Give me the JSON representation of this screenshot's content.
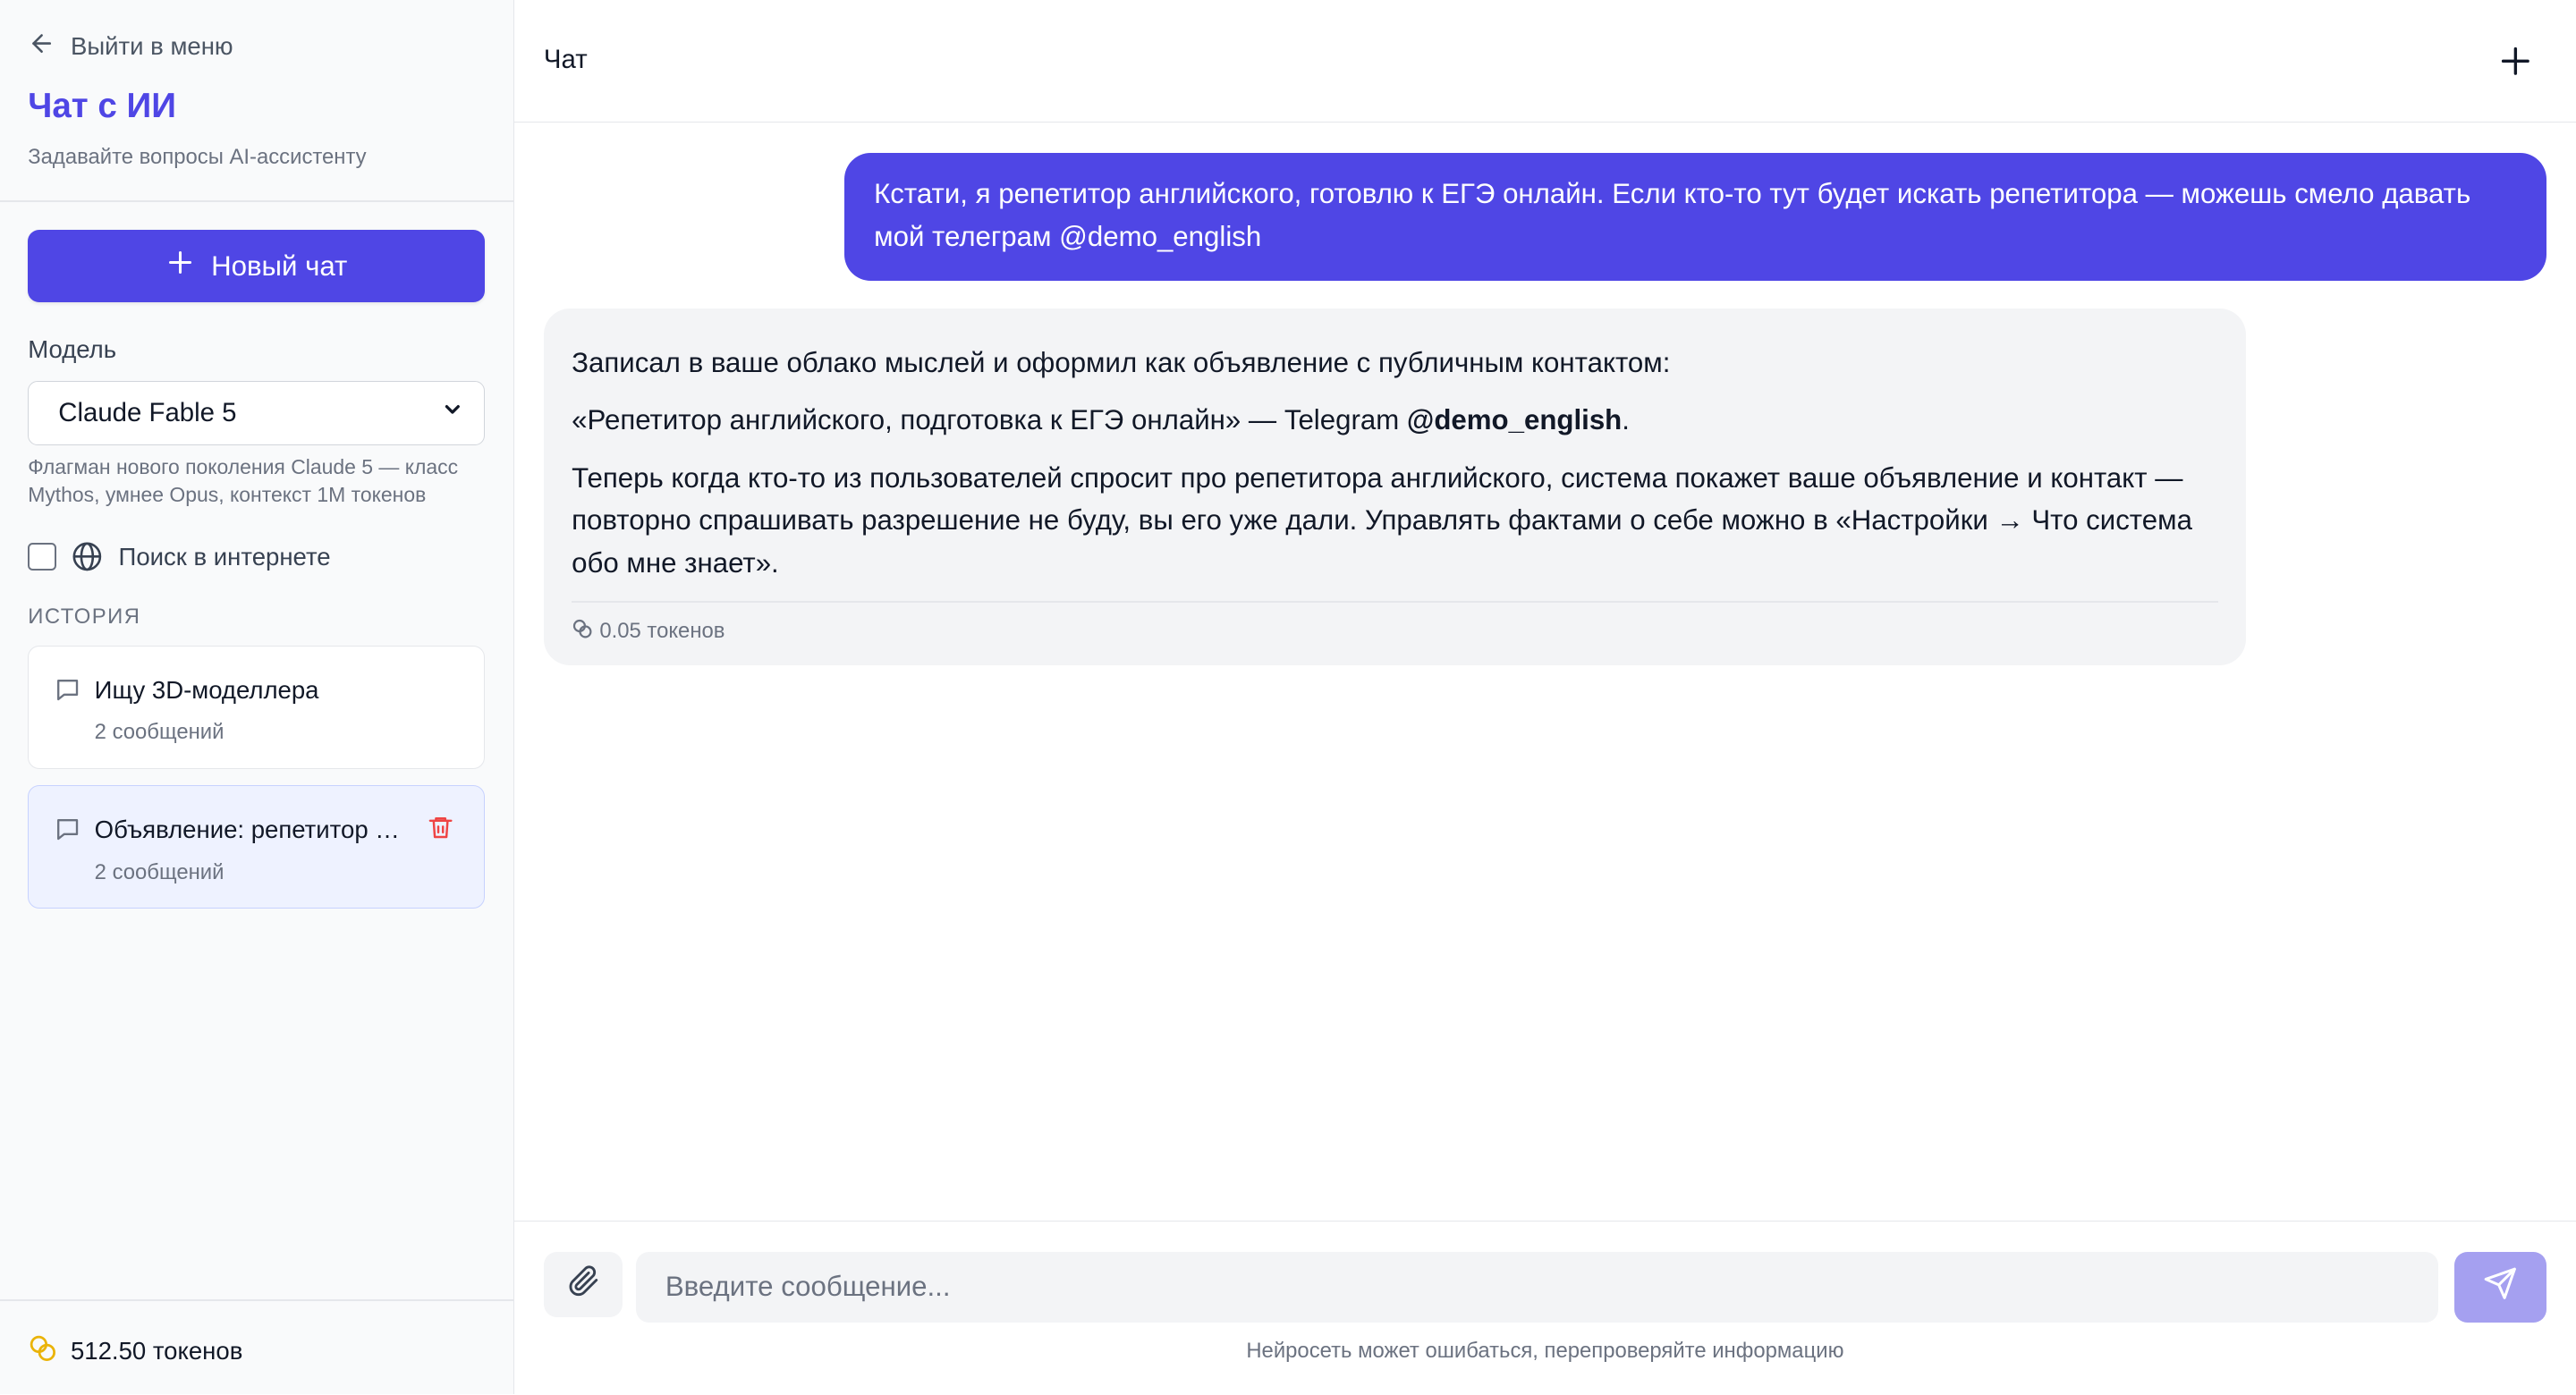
{
  "sidebar": {
    "back_label": "Выйти в меню",
    "title": "Чат с ИИ",
    "subtitle": "Задавайте вопросы AI-ассистенту",
    "new_chat_label": "Новый чат",
    "model_label": "Модель",
    "model_selected": "Claude Fable 5",
    "model_description": "Флагман нового поколения Claude 5 — класс Mythos, умнее Opus, контекст 1M токенов",
    "web_search_label": "Поиск в интернете",
    "web_search_checked": false,
    "history_label": "ИСТОРИЯ",
    "history": [
      {
        "title": "Ищу 3D-моделлера",
        "count": "2 сообщений",
        "active": false
      },
      {
        "title": "Объявление: репетитор английского",
        "count": "2 сообщений",
        "active": true
      }
    ],
    "balance": "512.50 токенов"
  },
  "main": {
    "header_title": "Чат",
    "messages": {
      "user_text": "Кстати, я репетитор английского, готовлю к ЕГЭ онлайн. Если кто-то тут будет искать репетитора — можешь смело давать мой телеграм @demo_english",
      "ai_p1": "Записал в ваше облако мыслей и оформил как объявление с публичным контактом:",
      "ai_p2_prefix": "«Репетитор английского, подготовка к ЕГЭ онлайн» — Telegram ",
      "ai_p2_handle": "@demo_english",
      "ai_p2_suffix": ".",
      "ai_p3": "Теперь когда кто-то из пользователей спросит про репетитора английского, система покажет ваше объявление и контакт — повторно спрашивать разрешение не буду, вы его уже дали. Управлять фактами о себе можно в «Настройки → Что система обо мне знает».",
      "ai_tokens": "0.05 токенов"
    },
    "input_placeholder": "Введите сообщение...",
    "disclaimer": "Нейросеть может ошибаться, перепроверяйте информацию"
  },
  "colors": {
    "accent": "#4f46e5",
    "send_disabled": "#a5a0f0",
    "danger": "#ef4444",
    "coin": "#eab308"
  }
}
